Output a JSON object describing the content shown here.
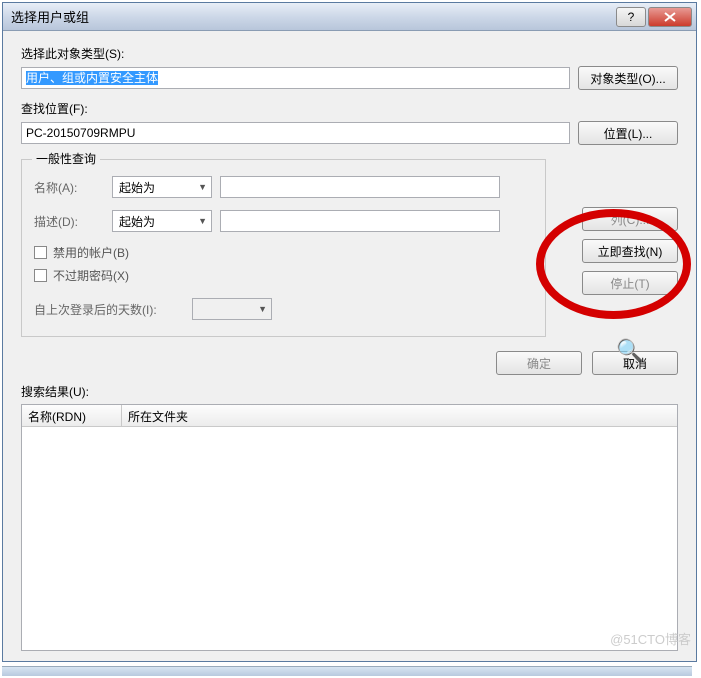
{
  "title": "选择用户或组",
  "labels": {
    "object_type": "选择此对象类型(S):",
    "object_type_value": "用户、组或内置安全主体",
    "btn_object_types": "对象类型(O)...",
    "from_location": "查找位置(F):",
    "from_location_value": "PC-20150709RMPU",
    "btn_locations": "位置(L)...",
    "general_query": "一般性查询",
    "name": "名称(A):",
    "description": "描述(D):",
    "starts_with": "起始为",
    "disabled_accounts": "禁用的帐户(B)",
    "non_expiring_pw": "不过期密码(X)",
    "days_since_login": "自上次登录后的天数(I):",
    "btn_columns": "列(C)...",
    "btn_find_now": "立即查找(N)",
    "btn_stop": "停止(T)",
    "btn_ok": "确定",
    "btn_cancel": "取消",
    "search_results": "搜索结果(U):",
    "col_name": "名称(RDN)",
    "col_folder": "所在文件夹"
  },
  "watermark": "@51CTO博客"
}
